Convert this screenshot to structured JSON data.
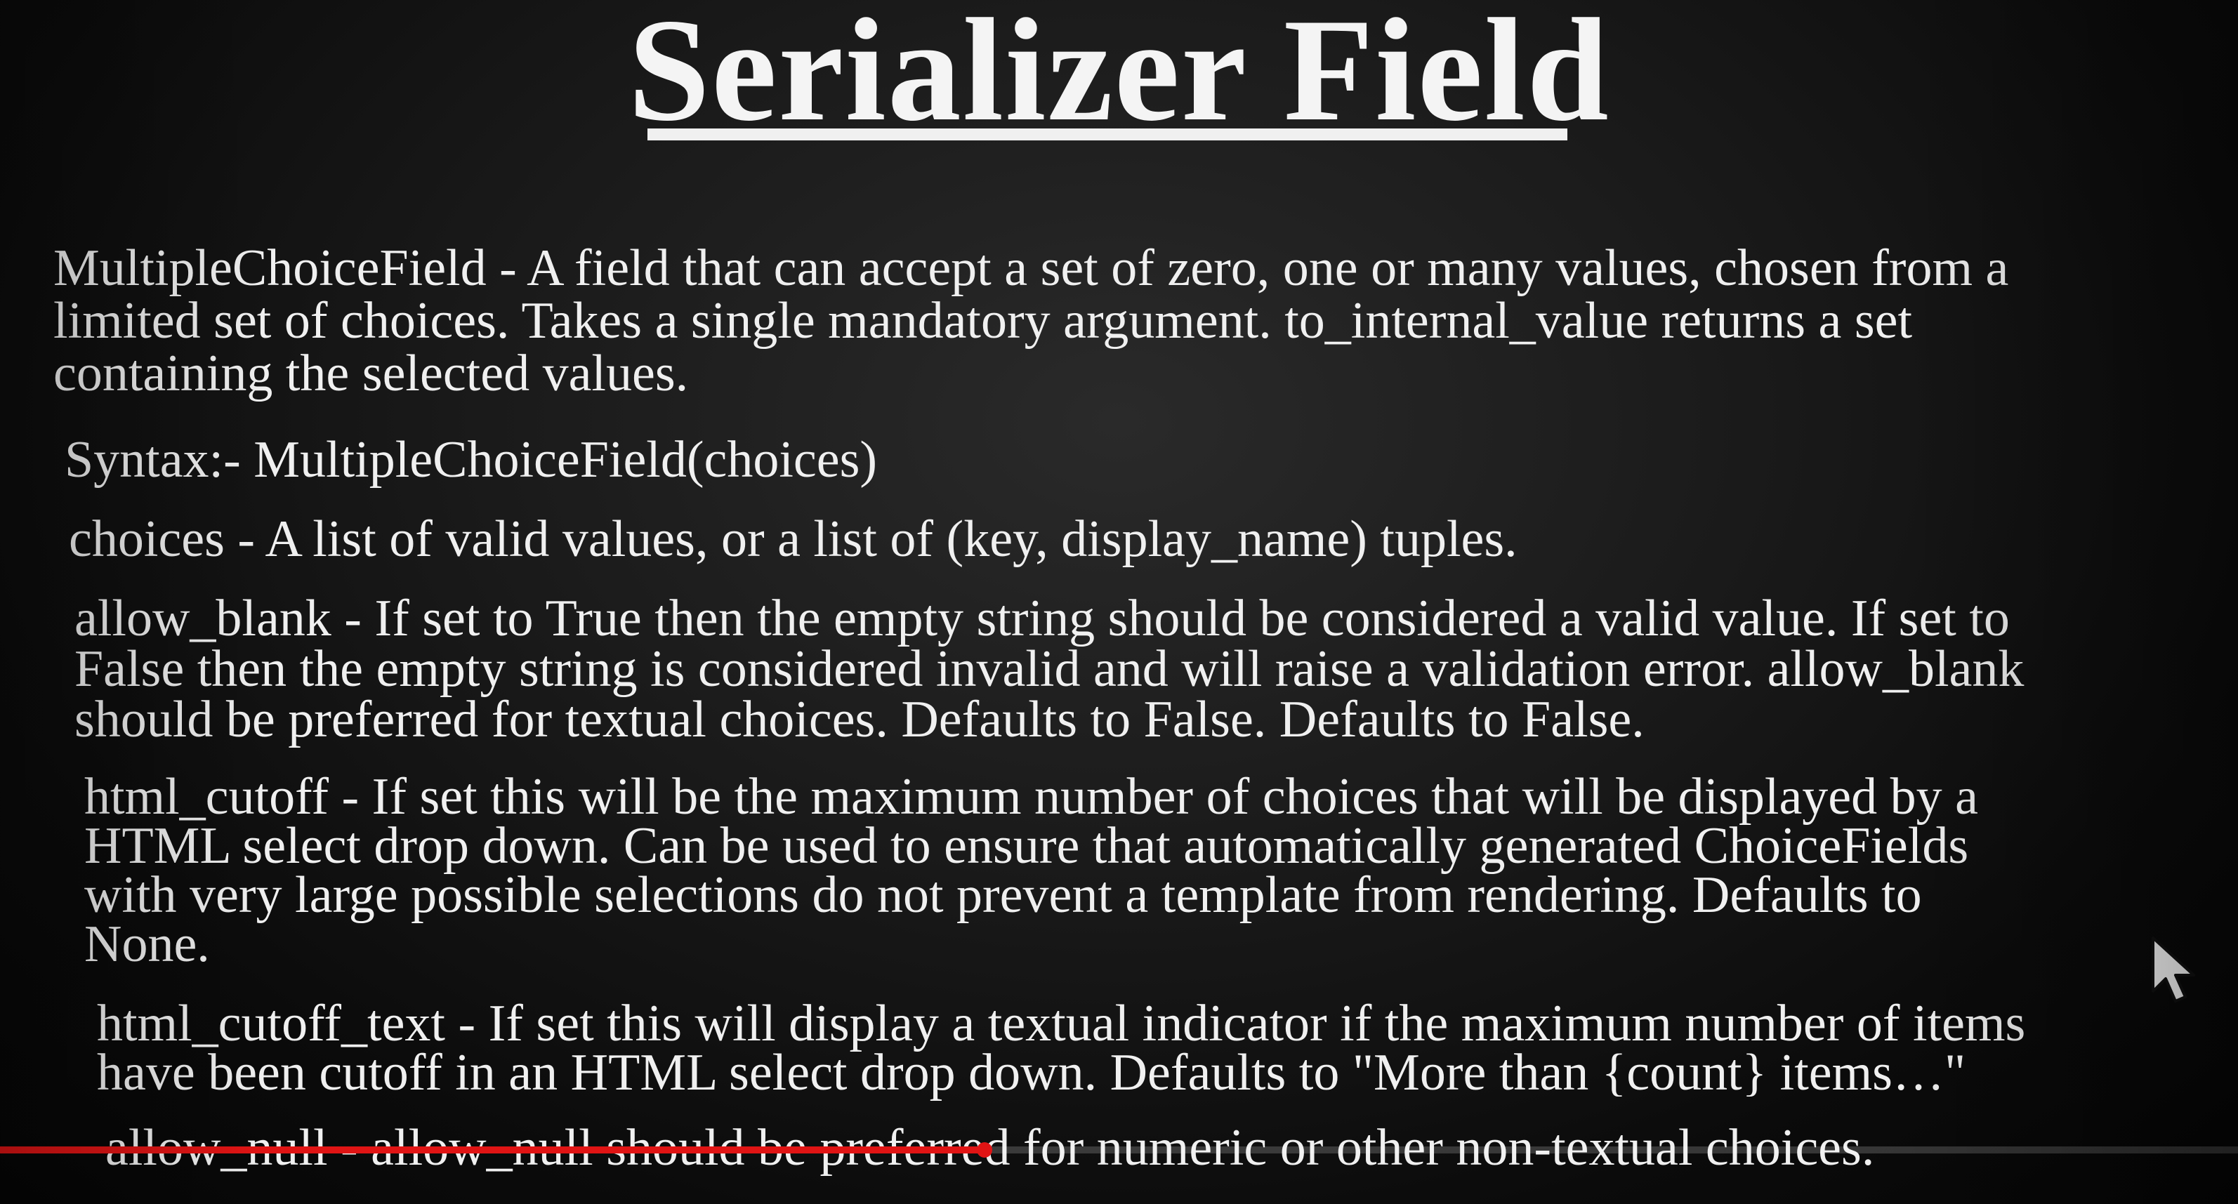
{
  "slide": {
    "title": "Serializer Field",
    "paragraphs": {
      "multiple_choice": [
        "MultipleChoiceField - A field that can accept a set of zero, one or many values, chosen from a",
        "limited set of choices. Takes a single mandatory argument. to_internal_value returns a set",
        "containing the selected values."
      ],
      "syntax": "Syntax:- MultipleChoiceField(choices)",
      "choices": "choices - A list of valid values, or a list of (key, display_name) tuples.",
      "allow_blank": [
        "allow_blank - If set to True then the empty string should be considered a valid value. If set to",
        "False then the empty string is considered invalid and will raise a validation error. allow_blank",
        "should be preferred for textual choices. Defaults to False. Defaults to False."
      ],
      "html_cutoff": [
        "html_cutoff - If set this will be the maximum number of choices that will be displayed by a",
        "HTML select drop down. Can be used to ensure that automatically generated ChoiceFields",
        "with very large possible selections do not prevent a template from rendering. Defaults to",
        "None."
      ],
      "html_cutoff_text": [
        "html_cutoff_text - If set this will display a textual indicator if the maximum number of items",
        "have been cutoff in an HTML select drop down. Defaults to \"More than {count} items…\""
      ],
      "allow_null": "allow_null - allow_null should be preferred for numeric or other non-textual choices."
    }
  },
  "player": {
    "progress_fraction": 0.44,
    "progress_color": "#e01414"
  },
  "icons": {
    "cursor": "mouse-pointer-icon"
  }
}
